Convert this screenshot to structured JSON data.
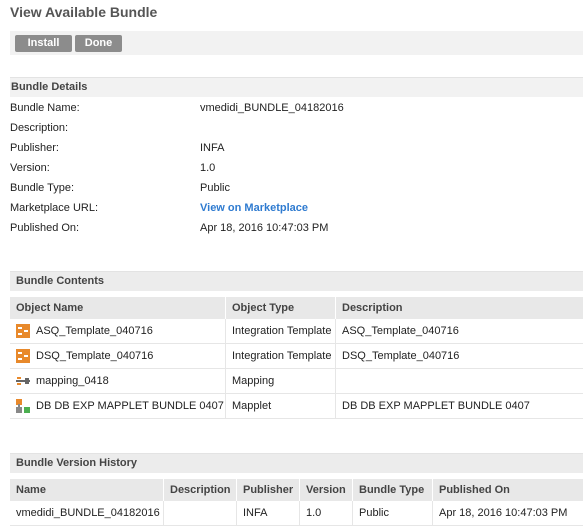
{
  "page": {
    "title": "View Available Bundle"
  },
  "toolbar": {
    "install_label": "Install",
    "done_label": "Done"
  },
  "bundle_details": {
    "heading": "Bundle Details",
    "fields": [
      {
        "label": "Bundle Name:",
        "value": "vmedidi_BUNDLE_04182016"
      },
      {
        "label": "Description:",
        "value": ""
      },
      {
        "label": "Publisher:",
        "value": "INFA"
      },
      {
        "label": "Version:",
        "value": "1.0"
      },
      {
        "label": "Bundle Type:",
        "value": "Public"
      },
      {
        "label": "Marketplace URL:",
        "value": "View on Marketplace"
      },
      {
        "label": "Published On:",
        "value": "Apr 18, 2016 10:47:03 PM"
      }
    ]
  },
  "bundle_contents": {
    "heading": "Bundle Contents",
    "columns": [
      "Object Name",
      "Object Type",
      "Description"
    ],
    "rows": [
      {
        "icon": "integration-template-icon",
        "name": "ASQ_Template_040716",
        "type": "Integration Template",
        "description": "ASQ_Template_040716"
      },
      {
        "icon": "integration-template-icon",
        "name": "DSQ_Template_040716",
        "type": "Integration Template",
        "description": "DSQ_Template_040716"
      },
      {
        "icon": "mapping-icon",
        "name": "mapping_0418",
        "type": "Mapping",
        "description": ""
      },
      {
        "icon": "mapplet-icon",
        "name": "DB DB EXP MAPPLET BUNDLE 0407",
        "type": "Mapplet",
        "description": "DB DB EXP MAPPLET BUNDLE 0407"
      }
    ]
  },
  "version_history": {
    "heading": "Bundle Version History",
    "columns": [
      "Name",
      "Description",
      "Publisher",
      "Version",
      "Bundle Type",
      "Published On"
    ],
    "rows": [
      {
        "name": "vmedidi_BUNDLE_04182016",
        "description": "",
        "publisher": "INFA",
        "version": "1.0",
        "bundle_type": "Public",
        "published_on": "Apr 18, 2016 10:47:03 PM"
      }
    ]
  },
  "colors": {
    "link": "#2f7bd0",
    "button": "#8c8c8c",
    "template_icon": "#e8892b",
    "mapplet_icon_green": "#4caf50"
  }
}
